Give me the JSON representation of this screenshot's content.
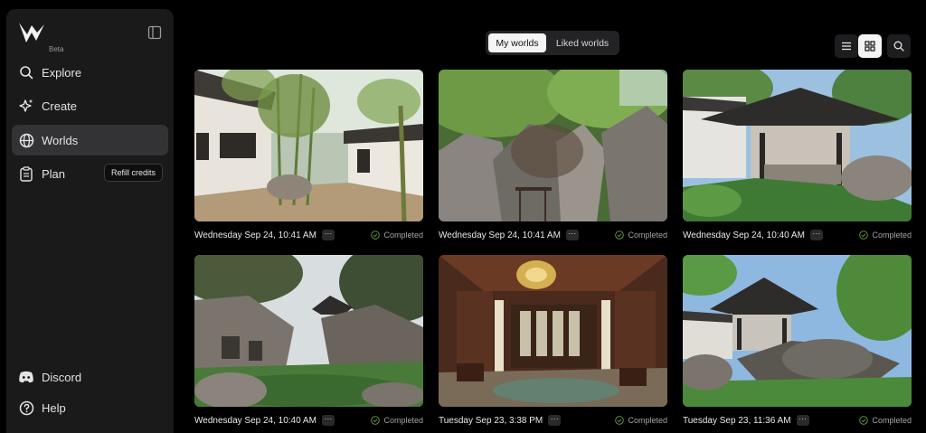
{
  "app": {
    "badge": "Beta"
  },
  "sidebar": {
    "items": [
      {
        "label": "Explore",
        "icon": "search-icon"
      },
      {
        "label": "Create",
        "icon": "sparkle-icon"
      },
      {
        "label": "Worlds",
        "icon": "globe-icon",
        "active": true
      },
      {
        "label": "Plan",
        "icon": "clipboard-icon"
      },
      {
        "label": "Discord",
        "icon": "discord-icon"
      },
      {
        "label": "Help",
        "icon": "help-icon"
      }
    ],
    "refill_label": "Refill credits"
  },
  "tabs": {
    "mine": "My worlds",
    "liked": "Liked worlds"
  },
  "cards": [
    {
      "date": "Wednesday Sep 24, 10:41 AM",
      "menu": "···",
      "status": "Completed"
    },
    {
      "date": "Wednesday Sep 24, 10:41 AM",
      "menu": "···",
      "status": "Completed"
    },
    {
      "date": "Wednesday Sep 24, 10:40 AM",
      "menu": "···",
      "status": "Completed"
    },
    {
      "date": "Wednesday Sep 24, 10:40 AM",
      "menu": "···",
      "status": "Completed"
    },
    {
      "date": "Tuesday Sep 23, 3:38 PM",
      "menu": "···",
      "status": "Completed"
    },
    {
      "date": "Tuesday Sep 23, 11:36 AM",
      "menu": "···",
      "status": "Completed"
    }
  ],
  "colors": {
    "accent": "#f4f4f4",
    "sidebar": "#1a1a1b",
    "active": "#333335",
    "status": "#a4a4a4"
  }
}
